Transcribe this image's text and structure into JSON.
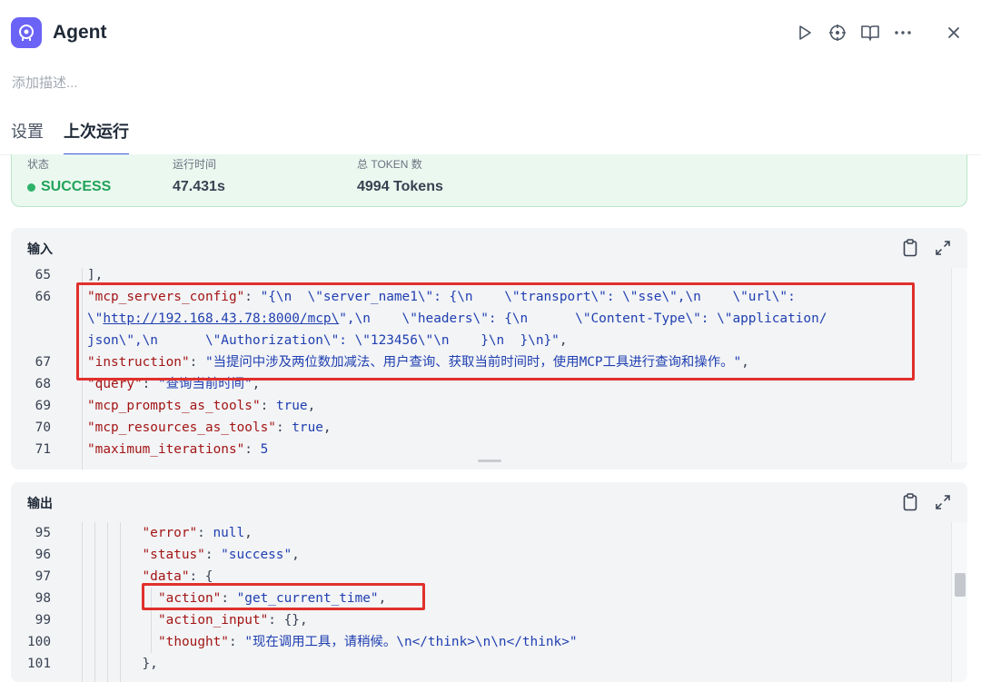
{
  "app": {
    "title": "Agent",
    "icon": "agent-brain-icon",
    "accent": "#6b63f6"
  },
  "header_actions": [
    "run-icon",
    "debug-target-icon",
    "docs-book-icon",
    "more-icon",
    "close-icon"
  ],
  "description_placeholder": "添加描述...",
  "tabs": [
    {
      "label": "设置",
      "active": false
    },
    {
      "label": "上次运行",
      "active": true
    }
  ],
  "status": {
    "status_label": "状态",
    "status_value": "SUCCESS",
    "time_label": "运行时间",
    "time_value": "47.431s",
    "tokens_label": "总 TOKEN 数",
    "tokens_value": "4994 Tokens"
  },
  "input_panel": {
    "title": "输入",
    "lines": [
      {
        "no": "65",
        "tokens": [
          [
            "p",
            "],"
          ]
        ]
      },
      {
        "no": "66",
        "tokens": [
          [
            "k",
            "\"mcp_servers_config\""
          ],
          [
            "p",
            ": "
          ],
          [
            "s",
            "\"{\\n  \\\"server_name1\\\": {\\n    \\\"transport\\\": \\\"sse\\\",\\n    \\\"url\\\":"
          ]
        ]
      },
      {
        "no": "",
        "tokens": [
          [
            "s",
            "\\\""
          ],
          [
            "su",
            "http://192.168.43.78:8000/mcp\\"
          ],
          [
            "s",
            "\",\\n    \\\"headers\\\": {\\n      \\\"Content-Type\\\": \\\"application/"
          ]
        ]
      },
      {
        "no": "",
        "tokens": [
          [
            "s",
            "json\\\",\\n      \\\"Authorization\\\": \\\"123456\\\"\\n    }\\n  }\\n}\""
          ],
          [
            "p",
            ","
          ]
        ]
      },
      {
        "no": "67",
        "tokens": [
          [
            "k",
            "\"instruction\""
          ],
          [
            "p",
            ": "
          ],
          [
            "s",
            "\"当提问中涉及两位数加减法、用户查询、获取当前时间时，使用MCP工具进行查询和操作。\""
          ],
          [
            "p",
            ","
          ]
        ]
      },
      {
        "no": "68",
        "tokens": [
          [
            "k",
            "\"query\""
          ],
          [
            "p",
            ": "
          ],
          [
            "s",
            "\"查询当前时间\""
          ],
          [
            "p",
            ","
          ]
        ]
      },
      {
        "no": "69",
        "tokens": [
          [
            "k",
            "\"mcp_prompts_as_tools\""
          ],
          [
            "p",
            ": "
          ],
          [
            "n",
            "true"
          ],
          [
            "p",
            ","
          ]
        ]
      },
      {
        "no": "70",
        "tokens": [
          [
            "k",
            "\"mcp_resources_as_tools\""
          ],
          [
            "p",
            ": "
          ],
          [
            "n",
            "true"
          ],
          [
            "p",
            ","
          ]
        ]
      },
      {
        "no": "71",
        "tokens": [
          [
            "k",
            "\"maximum_iterations\""
          ],
          [
            "p",
            ": "
          ],
          [
            "n",
            "5"
          ]
        ]
      }
    ]
  },
  "output_panel": {
    "title": "输出",
    "lines": [
      {
        "no": "95",
        "indent": 3,
        "tokens": [
          [
            "k",
            "\"error\""
          ],
          [
            "p",
            ": "
          ],
          [
            "n",
            "null"
          ],
          [
            "p",
            ","
          ]
        ]
      },
      {
        "no": "96",
        "indent": 3,
        "tokens": [
          [
            "k",
            "\"status\""
          ],
          [
            "p",
            ": "
          ],
          [
            "s",
            "\"success\""
          ],
          [
            "p",
            ","
          ]
        ]
      },
      {
        "no": "97",
        "indent": 3,
        "tokens": [
          [
            "k",
            "\"data\""
          ],
          [
            "p",
            ": {"
          ]
        ]
      },
      {
        "no": "98",
        "indent": 4,
        "tokens": [
          [
            "k",
            "\"action\""
          ],
          [
            "p",
            ": "
          ],
          [
            "s",
            "\"get_current_time\""
          ],
          [
            "p",
            ","
          ]
        ]
      },
      {
        "no": "99",
        "indent": 4,
        "tokens": [
          [
            "k",
            "\"action_input\""
          ],
          [
            "p",
            ": {},"
          ]
        ]
      },
      {
        "no": "100",
        "indent": 4,
        "tokens": [
          [
            "k",
            "\"thought\""
          ],
          [
            "p",
            ": "
          ],
          [
            "s",
            "\"现在调用工具，请稍候。\\n</think>\\n\\n</think>\""
          ]
        ]
      },
      {
        "no": "101",
        "indent": 3,
        "tokens": [
          [
            "p",
            "},"
          ]
        ]
      }
    ]
  },
  "panel_icons": [
    "copy-clipboard-icon",
    "expand-icon"
  ],
  "colors": {
    "key": "#a31515",
    "string": "#1f3fb0",
    "highlight_box": "#e0302c",
    "success": "#22a35a"
  }
}
